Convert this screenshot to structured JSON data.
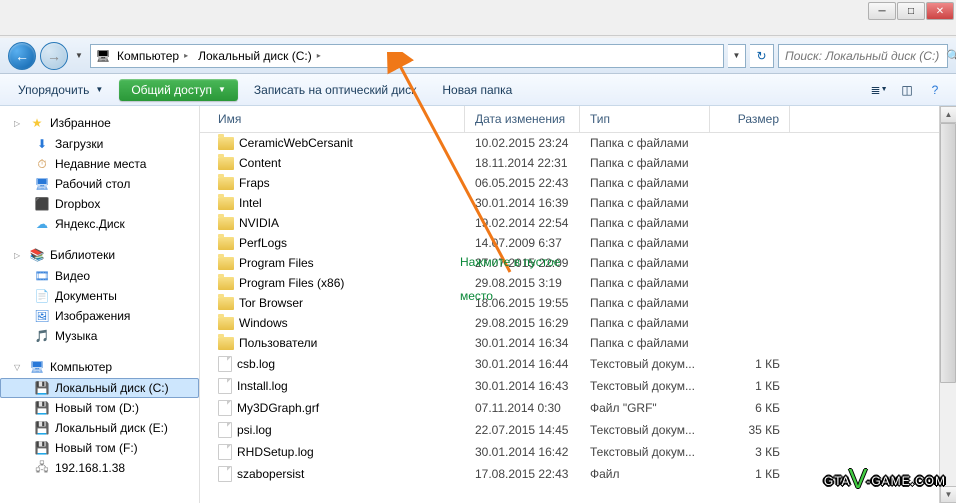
{
  "window": {
    "min": "─",
    "max": "□",
    "close": "✕"
  },
  "nav": {
    "crumb1": "Компьютер",
    "crumb2": "Локальный диск (C:)",
    "search_placeholder": "Поиск: Локальный диск (C:)"
  },
  "toolbar": {
    "organize": "Упорядочить",
    "share": "Общий доступ",
    "burn": "Записать на оптический диск",
    "newfolder": "Новая папка"
  },
  "headers": {
    "name": "Имя",
    "date": "Дата изменения",
    "type": "Тип",
    "size": "Размер"
  },
  "sidebar": {
    "favorites": "Избранное",
    "fav_items": [
      {
        "icon": "⬇",
        "label": "Загрузки",
        "color": "#2878d8"
      },
      {
        "icon": "⏱",
        "label": "Недавние места",
        "color": "#c88838"
      },
      {
        "icon": "🖥",
        "label": "Рабочий стол",
        "color": "#2878d8"
      },
      {
        "icon": "⬛",
        "label": "Dropbox",
        "color": "#0061ff"
      },
      {
        "icon": "☁",
        "label": "Яндекс.Диск",
        "color": "#48a8e8"
      }
    ],
    "libraries": "Библиотеки",
    "lib_items": [
      {
        "icon": "🎞",
        "label": "Видео",
        "color": "#2878d8"
      },
      {
        "icon": "📄",
        "label": "Документы",
        "color": "#c88838"
      },
      {
        "icon": "🖼",
        "label": "Изображения",
        "color": "#2878d8"
      },
      {
        "icon": "🎵",
        "label": "Музыка",
        "color": "#2878d8"
      }
    ],
    "computer": "Компьютер",
    "comp_items": [
      {
        "icon": "💾",
        "label": "Локальный диск (C:)",
        "sel": true
      },
      {
        "icon": "💾",
        "label": "Новый том (D:)"
      },
      {
        "icon": "💾",
        "label": "Локальный диск (E:)"
      },
      {
        "icon": "💾",
        "label": "Новый том (F:)"
      },
      {
        "icon": "🖧",
        "label": "192.168.1.38"
      }
    ]
  },
  "files": [
    {
      "t": "d",
      "name": "CeramicWebCersanit",
      "date": "10.02.2015 23:24",
      "type": "Папка с файлами",
      "size": ""
    },
    {
      "t": "d",
      "name": "Content",
      "date": "18.11.2014 22:31",
      "type": "Папка с файлами",
      "size": ""
    },
    {
      "t": "d",
      "name": "Fraps",
      "date": "06.05.2015 22:43",
      "type": "Папка с файлами",
      "size": ""
    },
    {
      "t": "d",
      "name": "Intel",
      "date": "30.01.2014 16:39",
      "type": "Папка с файлами",
      "size": ""
    },
    {
      "t": "d",
      "name": "NVIDIA",
      "date": "19.02.2014 22:54",
      "type": "Папка с файлами",
      "size": ""
    },
    {
      "t": "d",
      "name": "PerfLogs",
      "date": "14.07.2009 6:37",
      "type": "Папка с файлами",
      "size": ""
    },
    {
      "t": "d",
      "name": "Program Files",
      "date": "27.07.2015 22:09",
      "type": "Папка с файлами",
      "size": ""
    },
    {
      "t": "d",
      "name": "Program Files (x86)",
      "date": "29.08.2015 3:19",
      "type": "Папка с файлами",
      "size": ""
    },
    {
      "t": "d",
      "name": "Tor Browser",
      "date": "18.06.2015 19:55",
      "type": "Папка с файлами",
      "size": ""
    },
    {
      "t": "d",
      "name": "Windows",
      "date": "29.08.2015 16:29",
      "type": "Папка с файлами",
      "size": ""
    },
    {
      "t": "d",
      "name": "Пользователи",
      "date": "30.01.2014 16:34",
      "type": "Папка с файлами",
      "size": ""
    },
    {
      "t": "f",
      "name": "csb.log",
      "date": "30.01.2014 16:44",
      "type": "Текстовый докум...",
      "size": "1 КБ"
    },
    {
      "t": "f",
      "name": "Install.log",
      "date": "30.01.2014 16:43",
      "type": "Текстовый докум...",
      "size": "1 КБ"
    },
    {
      "t": "f",
      "name": "My3DGraph.grf",
      "date": "07.11.2014 0:30",
      "type": "Файл \"GRF\"",
      "size": "6 КБ"
    },
    {
      "t": "f",
      "name": "psi.log",
      "date": "22.07.2015 14:45",
      "type": "Текстовый докум...",
      "size": "35 КБ"
    },
    {
      "t": "f",
      "name": "RHDSetup.log",
      "date": "30.01.2014 16:42",
      "type": "Текстовый докум...",
      "size": "3 КБ"
    },
    {
      "t": "f",
      "name": "szabopersist",
      "date": "17.08.2015 22:43",
      "type": "Файл",
      "size": "1 КБ"
    }
  ],
  "annotation": {
    "line1": "Нажмите в пустое",
    "line2": "место"
  },
  "watermark": {
    "p1": "GTA",
    "v": "V",
    "p2": "-GAME.COM"
  }
}
